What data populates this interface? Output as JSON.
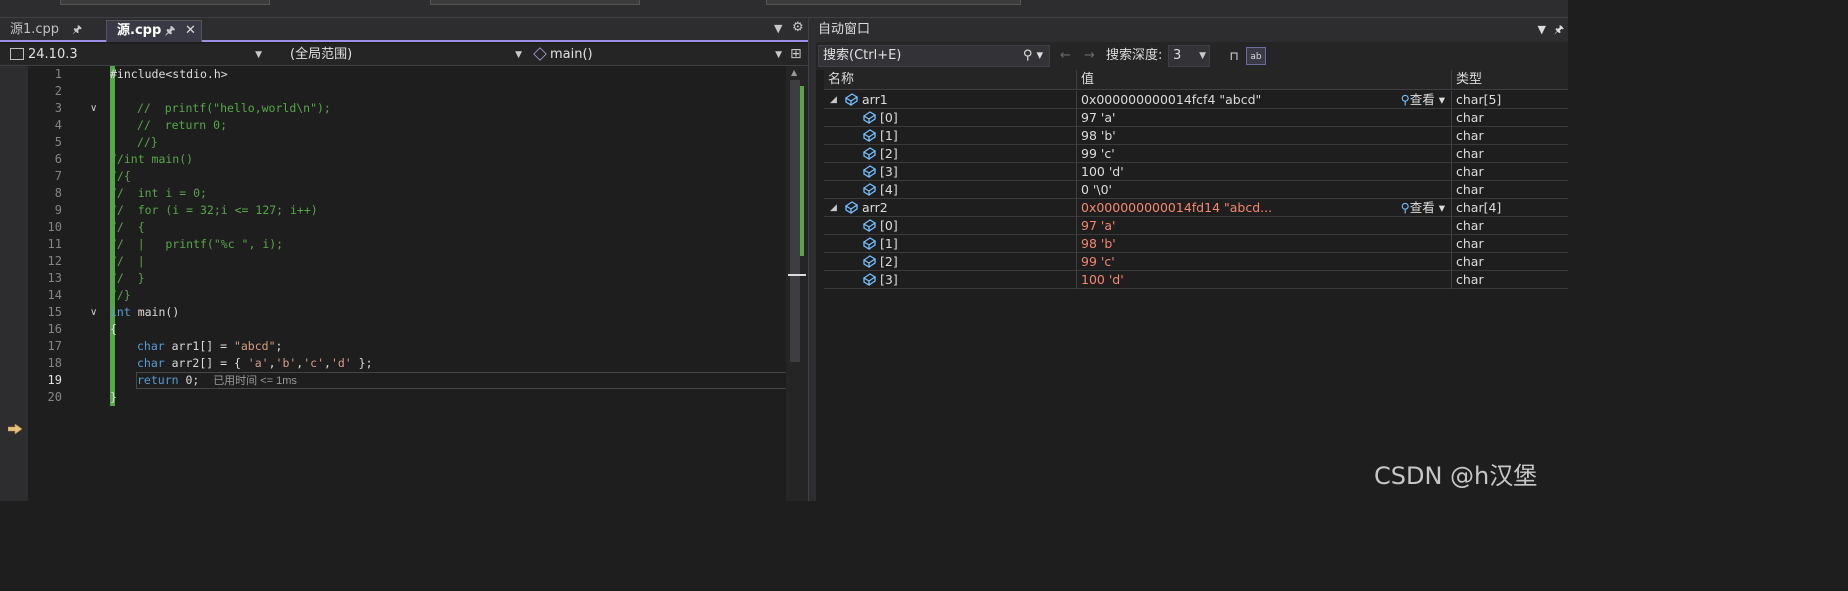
{
  "editor": {
    "tabs": [
      {
        "label": "源1.cpp",
        "pin": "🖈"
      },
      {
        "label": "源.cpp",
        "pin": "🖈",
        "close": "✕"
      }
    ],
    "nav": {
      "project": "24.10.3",
      "scope": "(全局范围)",
      "member": "main()"
    },
    "lines": [
      {
        "n": "1"
      },
      {
        "n": "2"
      },
      {
        "n": "3"
      },
      {
        "n": "4"
      },
      {
        "n": "5"
      },
      {
        "n": "6"
      },
      {
        "n": "7"
      },
      {
        "n": "8"
      },
      {
        "n": "9"
      },
      {
        "n": "10"
      },
      {
        "n": "11"
      },
      {
        "n": "12"
      },
      {
        "n": "13"
      },
      {
        "n": "14"
      },
      {
        "n": "15"
      },
      {
        "n": "16"
      },
      {
        "n": "17"
      },
      {
        "n": "18"
      },
      {
        "n": "19"
      },
      {
        "n": "20"
      }
    ],
    "code": {
      "l1": "#include<stdio.h>",
      "l3": "//  printf(\"hello,world\\n\");",
      "l4": "//  return 0;",
      "l5": "//}",
      "l6": "//int main()",
      "l7": "//{",
      "l8": "//  int i = 0;",
      "l9": "//  for (i = 32;i <= 127; i++)",
      "l10": "//  {",
      "l11": "//  |   printf(\"%c \", i);",
      "l12": "//  |",
      "l13": "//  }",
      "l14": "//}",
      "l15_kw": "int",
      "l15_rest": " main()",
      "l16": "{",
      "l17_kw": "char",
      "l17_mid": " arr1[] = ",
      "l17_str": "\"abcd\"",
      "l17_end": ";",
      "l18_kw": "char",
      "l18_mid": " arr2[] = { ",
      "l18_c1": "'a'",
      "l18_c2": "'b'",
      "l18_c3": "'c'",
      "l18_c4": "'d'",
      "l18_end": " };",
      "l19_kw": "return",
      "l19_rest": " 0;",
      "l19_hint": "已用时间 <= 1ms",
      "l20": "}"
    }
  },
  "autos": {
    "title": "自动窗口",
    "search_placeholder": "搜索(Ctrl+E)",
    "search_depth_label": "搜索深度:",
    "search_depth_value": "3",
    "columns": {
      "name": "名称",
      "value": "值",
      "type": "类型"
    },
    "view_label": "查看",
    "rows": [
      {
        "name": "arr1",
        "value": "0x000000000014fcf4 \"abcd\"",
        "type": "char[5]"
      },
      {
        "name": "[0]",
        "value": "97 'a'",
        "type": "char"
      },
      {
        "name": "[1]",
        "value": "98 'b'",
        "type": "char"
      },
      {
        "name": "[2]",
        "value": "99 'c'",
        "type": "char"
      },
      {
        "name": "[3]",
        "value": "100 'd'",
        "type": "char"
      },
      {
        "name": "[4]",
        "value": "0 '\\0'",
        "type": "char"
      },
      {
        "name": "arr2",
        "value": "0x000000000014fd14 \"abcd...",
        "type": "char[4]"
      },
      {
        "name": "[0]",
        "value": "97 'a'",
        "type": "char"
      },
      {
        "name": "[1]",
        "value": "98 'b'",
        "type": "char"
      },
      {
        "name": "[2]",
        "value": "99 'c'",
        "type": "char"
      },
      {
        "name": "[3]",
        "value": "100 'd'",
        "type": "char"
      }
    ]
  },
  "watermark": "CSDN @h汉堡"
}
